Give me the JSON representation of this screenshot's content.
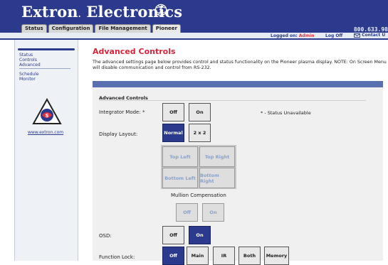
{
  "header": {
    "brand": "Extron",
    "brand_dot": ".",
    "brand_tail": "Electronics",
    "phone": "800.633.98",
    "logged_label": "Logged on:",
    "user": "Admin",
    "logoff": "Log Off",
    "contact": "Contact U",
    "accent": "#2b3a8c",
    "alert": "#e6303b"
  },
  "tabs": [
    {
      "label": "Status"
    },
    {
      "label": "Configuration"
    },
    {
      "label": "File Management"
    },
    {
      "label": "Pioneer"
    }
  ],
  "sidebar": {
    "status": "Status",
    "controls": "Controls",
    "advanced": "Advanced",
    "schedule": "Schedule",
    "monitor": "Monitor",
    "link": "www.extron.com",
    "seal_icon": "extron-seal-icon"
  },
  "main": {
    "title": "Advanced Controls",
    "description": "The advanced settings page below provides control and status functionality on the Pioneer plasma display. NOTE: On Screen Menu will disable communication and control from RS-232.",
    "panel_heading": "Advanced Controls",
    "integrator_label": "Integrator Mode: *",
    "status_note": "* - Status Unavailable",
    "display_layout_label": "Display Layout:",
    "mullion_label": "Mullion Compensation",
    "osd_label": "OSD:",
    "function_lock_label": "Function Lock:",
    "buttons": {
      "off": "Off",
      "on": "On",
      "normal": "Normal",
      "two_by_two": "2 x 2",
      "top_left": "Top Left",
      "top_right": "Top Right",
      "bottom_left": "Bottom Left",
      "bottom_right": "Bottom Right",
      "main": "Main",
      "ir": "IR",
      "both": "Both",
      "memory": "Memory"
    }
  }
}
